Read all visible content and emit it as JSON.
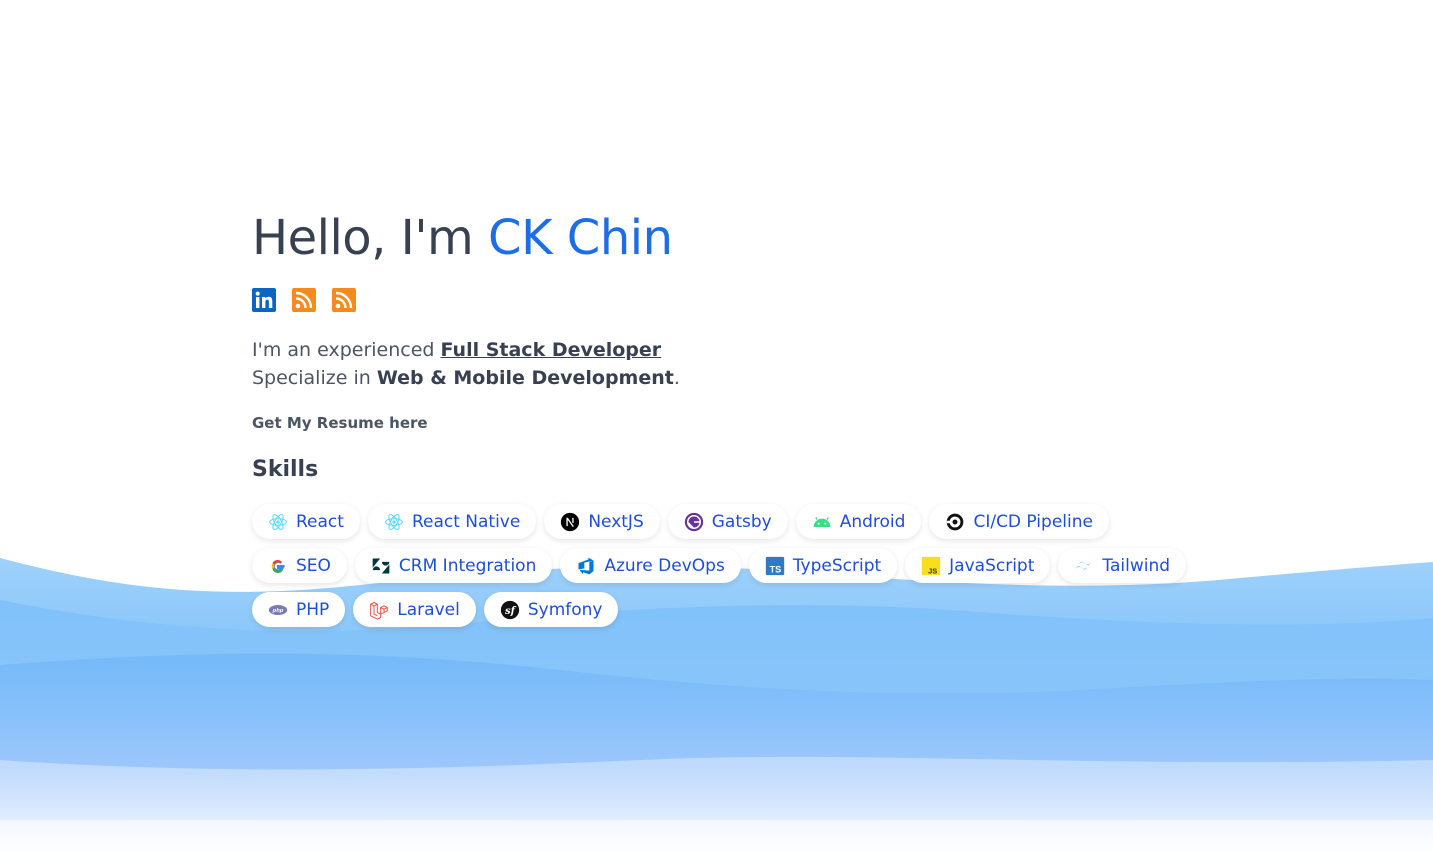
{
  "hero": {
    "greeting": "Hello, I'm ",
    "name": "CK Chin"
  },
  "socials": [
    {
      "icon": "linkedin-icon",
      "color": "#0a66c2"
    },
    {
      "icon": "rss-icon",
      "color": "#f58b1f"
    },
    {
      "icon": "rss-icon",
      "color": "#f58b1f"
    }
  ],
  "intro": {
    "line1_prefix": "I'm an experienced ",
    "role": "Full Stack Developer",
    "line2_prefix": "Specialize in ",
    "specialty": "Web & Mobile Development",
    "line2_suffix": "."
  },
  "resume_link": "Get My Resume here",
  "skills": {
    "title": "Skills",
    "items": [
      {
        "label": "React",
        "icon": "react-icon"
      },
      {
        "label": "React Native",
        "icon": "react-icon"
      },
      {
        "label": "NextJS",
        "icon": "nextjs-icon"
      },
      {
        "label": "Gatsby",
        "icon": "gatsby-icon"
      },
      {
        "label": "Android",
        "icon": "android-icon"
      },
      {
        "label": "CI/CD Pipeline",
        "icon": "circleci-icon"
      },
      {
        "label": "SEO",
        "icon": "google-icon"
      },
      {
        "label": "CRM Integration",
        "icon": "zendesk-icon"
      },
      {
        "label": "Azure DevOps",
        "icon": "azure-devops-icon"
      },
      {
        "label": "TypeScript",
        "icon": "typescript-icon"
      },
      {
        "label": "JavaScript",
        "icon": "javascript-icon"
      },
      {
        "label": "Tailwind",
        "icon": "tailwind-icon"
      },
      {
        "label": "PHP",
        "icon": "php-icon"
      },
      {
        "label": "Laravel",
        "icon": "laravel-icon"
      },
      {
        "label": "Symfony",
        "icon": "symfony-icon"
      }
    ]
  },
  "colors": {
    "accent": "#1d6ee6",
    "chip_text": "#1d4ed8",
    "text": "#374151",
    "wave": "#60a5fa"
  }
}
